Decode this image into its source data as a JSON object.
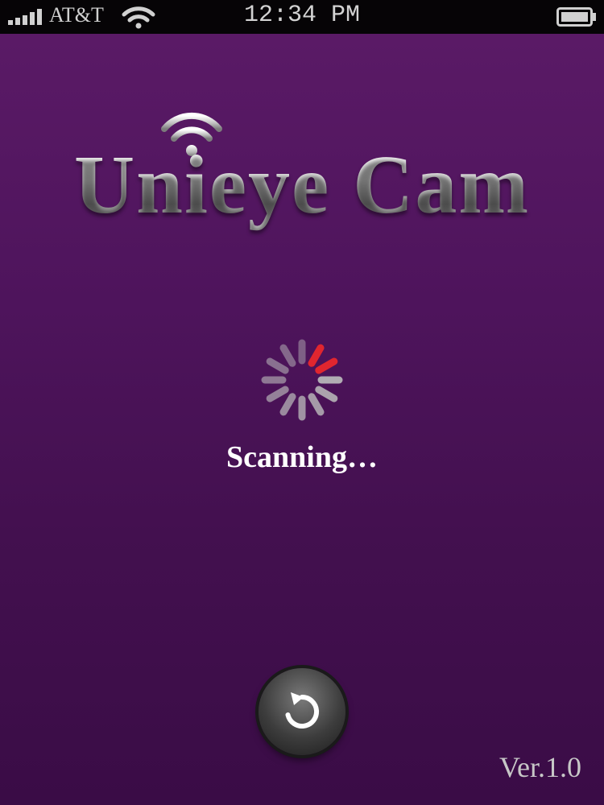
{
  "status_bar": {
    "carrier": "AT&T",
    "time": "12:34 PM",
    "signal_icon": "signal-bars-icon",
    "wifi_icon": "wifi-icon",
    "battery_icon": "battery-icon"
  },
  "app": {
    "title": "Unieye Cam",
    "logo_icon": "wifi-icon",
    "status_text": "Scanning…",
    "spinner_icon": "spinner-icon",
    "refresh_icon": "refresh-icon",
    "version": "Ver.1.0"
  },
  "colors": {
    "background": "#4e145c",
    "status_bar": "#060406",
    "spinner_active": "#e0262f",
    "spinner_idle": "#bdbdbd"
  }
}
